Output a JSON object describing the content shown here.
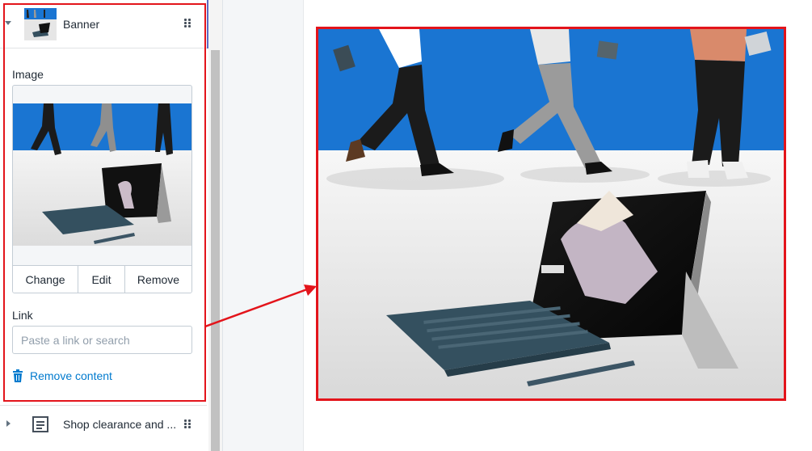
{
  "section": {
    "title": "Banner",
    "expanded": true
  },
  "image_field": {
    "label": "Image",
    "buttons": {
      "change": "Change",
      "edit": "Edit",
      "remove": "Remove"
    }
  },
  "link_field": {
    "label": "Link",
    "placeholder": "Paste a link or search",
    "value": ""
  },
  "remove_content": {
    "label": "Remove content",
    "icon": "trash-icon"
  },
  "next_section": {
    "title": "Shop clearance and ...",
    "icon": "text-document-icon"
  },
  "colors": {
    "annotation_red": "#e3141b",
    "link_blue": "#007ace",
    "banner_blue": "#1a75d2"
  }
}
